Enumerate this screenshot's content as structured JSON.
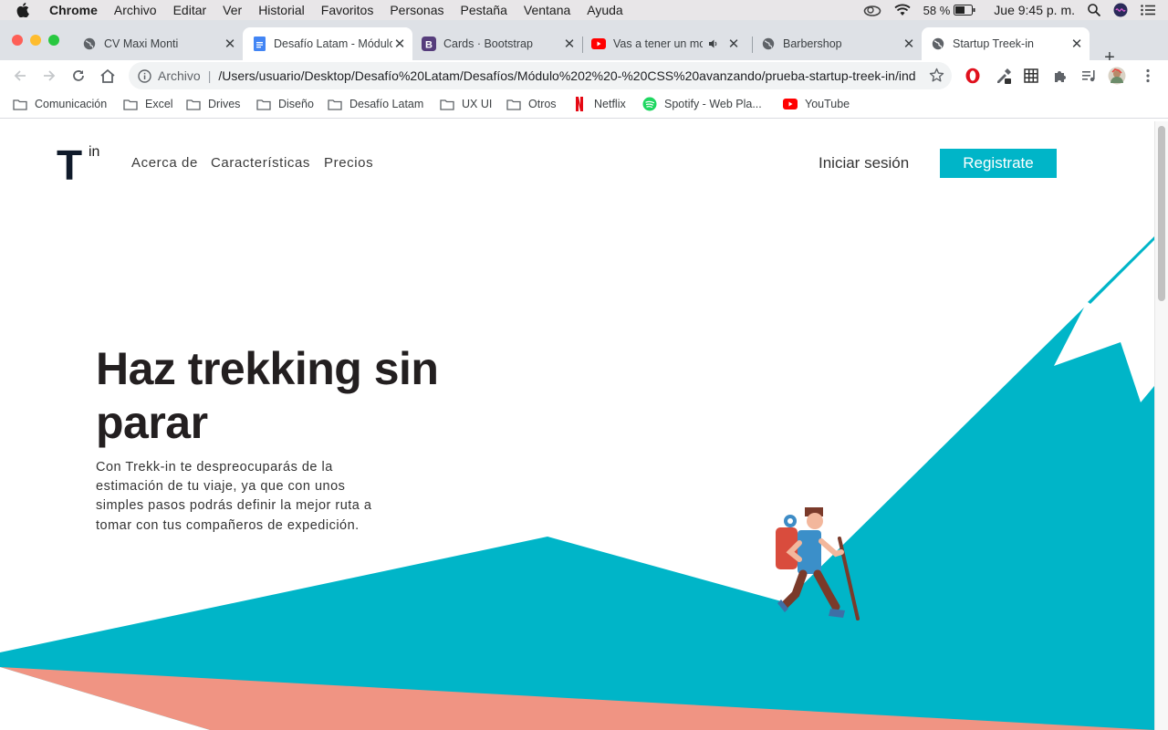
{
  "menubar": {
    "app": "Chrome",
    "items": [
      "Archivo",
      "Editar",
      "Ver",
      "Historial",
      "Favoritos",
      "Personas",
      "Pestaña",
      "Ventana",
      "Ayuda"
    ],
    "battery": "58 %",
    "clock": "Jue 9:45 p. m."
  },
  "tabs": [
    {
      "title": "CV Maxi Monti",
      "icon": "globe-icon"
    },
    {
      "title": "Desafío Latam - Módulo",
      "icon": "google-docs-icon"
    },
    {
      "title": "Cards · Bootstrap",
      "icon": "bootstrap-icon"
    },
    {
      "title": "Vas a tener un mo",
      "icon": "youtube-icon"
    },
    {
      "title": "Barbershop",
      "icon": "globe-icon"
    },
    {
      "title": "Startup Treek-in",
      "icon": "globe-icon"
    }
  ],
  "address": {
    "scheme_label": "Archivo",
    "url": "/Users/usuario/Desktop/Desafío%20Latam/Desafíos/Módulo%202%20-%20CSS%20avanzando/prueba-startup-treek-in/index.html"
  },
  "bookmarks": [
    {
      "label": "Comunicación",
      "icon": "folder-icon"
    },
    {
      "label": "Excel",
      "icon": "folder-icon"
    },
    {
      "label": "Drives",
      "icon": "folder-icon"
    },
    {
      "label": "Diseño",
      "icon": "folder-icon"
    },
    {
      "label": "Desafío Latam",
      "icon": "folder-icon"
    },
    {
      "label": "UX UI",
      "icon": "folder-icon"
    },
    {
      "label": "Otros",
      "icon": "folder-icon"
    },
    {
      "label": "Netflix",
      "icon": "netflix-icon"
    },
    {
      "label": "Spotify - Web Pla...",
      "icon": "spotify-icon"
    },
    {
      "label": "YouTube",
      "icon": "youtube-icon"
    }
  ],
  "site": {
    "logo_main": "T",
    "logo_sup": "in",
    "nav": [
      "Acerca de",
      "Características",
      "Precios"
    ],
    "login": "Iniciar sesión",
    "register": "Registrate",
    "hero_title": "Haz trekking sin parar",
    "hero_text": "Con Trekk-in te despreocuparás de la estimación de tu viaje, ya que con unos simples pasos podrás definir la mejor ruta a tomar con tus compañeros de expedición."
  },
  "colors": {
    "brand": "#00b5c8",
    "salmon": "#f09483",
    "dark": "#231f20"
  }
}
